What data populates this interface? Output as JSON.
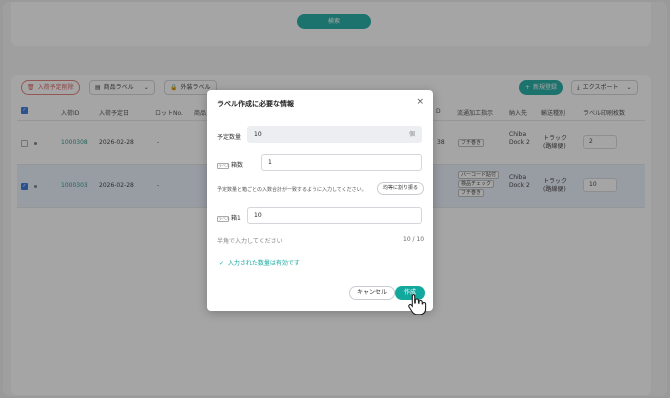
{
  "search": {
    "label": "検索"
  },
  "toolbar": {
    "delete_label": "入荷予定削除",
    "product_label": "商品ラベル",
    "outer_label": "外装ラベル",
    "new_label": "新規登録",
    "export_label": "エクスポート"
  },
  "table": {
    "headers": [
      "入荷ID",
      "入荷予定日",
      "ロットNo.",
      "商品",
      "D",
      "流通加工指示",
      "納入先",
      "輸送種別",
      "ラベル印刷枚数"
    ],
    "rows": [
      {
        "id": "1000308",
        "date": "2026-02-28",
        "lot": "-",
        "num": "38",
        "tags": [
          "フチ巻き"
        ],
        "dest": "Chiba Dock 2",
        "transport": "トラック (路線便)",
        "count": "2",
        "selected": false
      },
      {
        "id": "1000303",
        "date": "2026-02-28",
        "lot": "-",
        "num": "",
        "tags": [
          "バーコード貼付",
          "検品チェック",
          "フチ巻き"
        ],
        "dest": "Chiba Dock 2",
        "transport": "トラック (路線便)",
        "count": "10",
        "selected": true
      }
    ]
  },
  "modal": {
    "title": "ラベル作成に必要な情報",
    "close": "×",
    "planned_label": "予定数量",
    "planned_value": "10",
    "planned_unit": "個",
    "boxes_label": "箱数",
    "boxes_value": "1",
    "mini_tag": "ラベル",
    "hint": "予定数量と箱ごとの入数合計が一致するように入力してください。",
    "equal_button": "均等に割り振る",
    "box1_label": "箱1",
    "box1_value": "10",
    "halfwidth_hint": "半角で入力してください",
    "counter": "10 / 10",
    "valid_message": "入力された数量は有効です",
    "cancel": "キャンセル",
    "create": "作成"
  },
  "colors": {
    "accent": "#13a89e",
    "danger": "#d9534f",
    "selected_row": "#e9f0fb"
  }
}
